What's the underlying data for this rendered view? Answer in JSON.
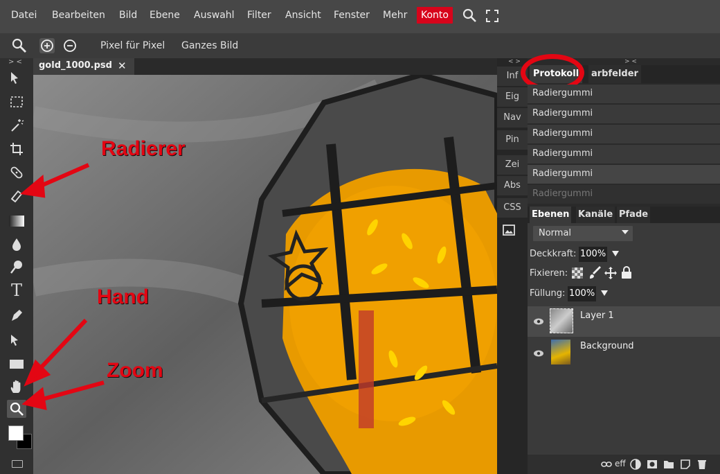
{
  "menubar": {
    "items": [
      "Datei",
      "Bearbeiten",
      "Bild",
      "Ebene",
      "Auswahl",
      "Filter",
      "Ansicht",
      "Fenster",
      "Mehr"
    ],
    "account": "Konto"
  },
  "options": {
    "pixel_fuer_pixel": "Pixel für Pixel",
    "ganzes_bild": "Ganzes Bild"
  },
  "toolbar": {
    "collapse": "> <"
  },
  "document": {
    "tab_name": "gold_1000.psd",
    "close": "✕"
  },
  "side_tabs": {
    "collapse": "< >",
    "items": [
      "Inf",
      "Eig",
      "Nav",
      "Pin",
      "Zei",
      "Abs",
      "CSS"
    ]
  },
  "right_panel": {
    "collapse": "> <",
    "history_tabs": [
      "Protokoll",
      "arbfelder"
    ],
    "history_items": [
      "Radiergummi",
      "Radiergummi",
      "Radiergummi",
      "Radiergummi",
      "Radiergummi",
      "Radiergummi"
    ],
    "layers_tabs": [
      "Ebenen",
      "Kanäle",
      "Pfade"
    ],
    "blend_mode": "Normal",
    "opacity_label": "Deckkraft:",
    "opacity_value": "100%",
    "lock_label": "Fixieren:",
    "fill_label": "Füllung:",
    "fill_value": "100%",
    "layers": [
      "Layer 1",
      "Background"
    ],
    "footer_eff": "eff"
  },
  "annotations": {
    "radierer": "Radierer",
    "hand": "Hand",
    "zoom": "Zoom"
  },
  "colors": {
    "accent_red": "#e30613",
    "konto_red": "#d7041b",
    "lantern_orange": "#f0a000"
  }
}
